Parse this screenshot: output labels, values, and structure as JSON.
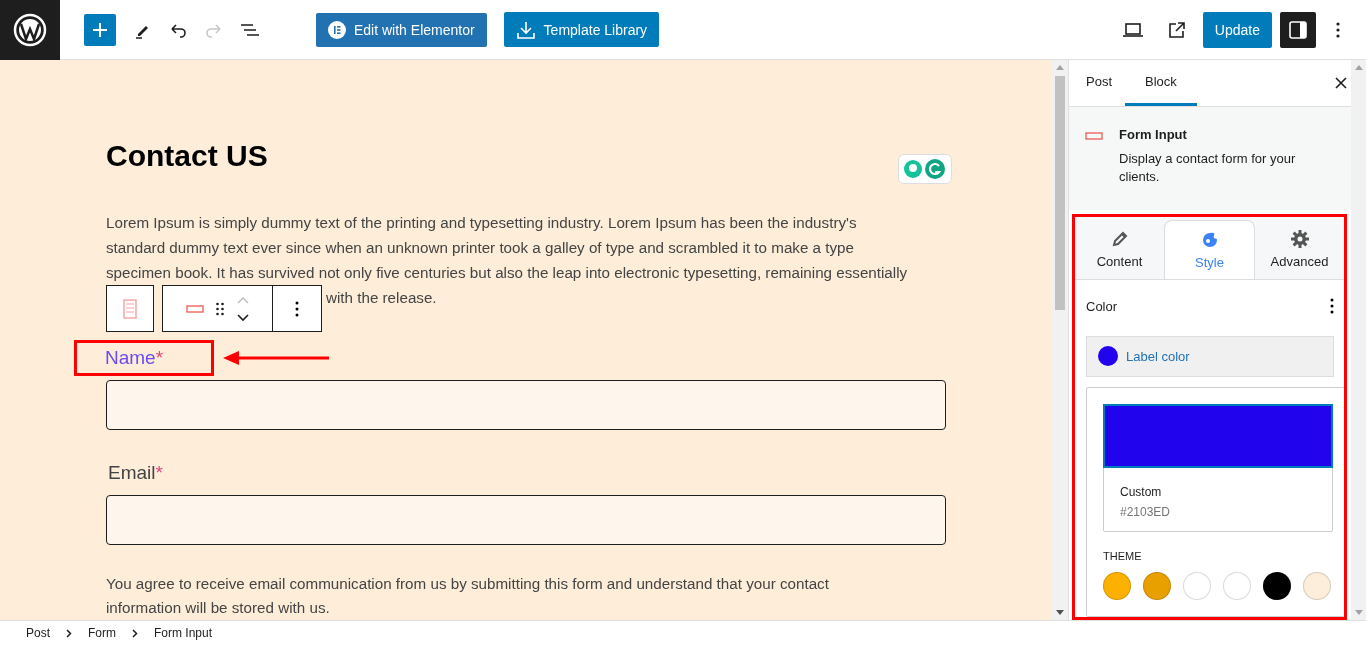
{
  "top_bar": {
    "elementor_button": "Edit with Elementor",
    "template_button": "Template Library",
    "update_button": "Update",
    "redo_disabled": true,
    "settings_open": true
  },
  "editor": {
    "title": "Contact US",
    "paragraph": "Lorem Ipsum is simply dummy text of the printing and typesetting industry. Lorem Ipsum has been the industry's standard dummy text ever since when an unknown printer took a galley of type and scrambled it to make a type specimen book. It has survived not only five centuries but also the leap into electronic typesetting, remaining essentially",
    "paragraph_tail": "with the release.",
    "fields": [
      {
        "label": "Name",
        "required_mark": "*",
        "color": "#6a4cf2",
        "highlighted": true
      },
      {
        "label": "Email",
        "required_mark": "*",
        "color": "#444444",
        "highlighted": false
      }
    ],
    "consent": "You agree to receive email communication from us by submitting this form and understand that your contact information will be stored with us."
  },
  "sidebar": {
    "tabs": [
      {
        "label": "Post",
        "selected": false
      },
      {
        "label": "Block",
        "selected": true
      }
    ],
    "block": {
      "title": "Form Input",
      "description": "Display a contact form for your clients."
    },
    "style_tabs": [
      {
        "label": "Content",
        "kind": "pencil",
        "selected": false
      },
      {
        "label": "Style",
        "kind": "palette",
        "selected": true
      },
      {
        "label": "Advanced",
        "kind": "gear",
        "selected": false
      }
    ],
    "color_panel": {
      "heading": "Color",
      "label_color": {
        "label": "Label color",
        "color": "#2103ed"
      },
      "picker": {
        "color": "#2103ed",
        "name": "Custom",
        "value": "#2103ED"
      },
      "theme_heading": "THEME",
      "swatches": [
        {
          "color": "#fcb000"
        },
        {
          "color": "#e8a000"
        },
        {
          "color": "#ffffff"
        },
        {
          "color": "#ffffff"
        },
        {
          "color": "#000000"
        },
        {
          "color": "#fdeedb"
        }
      ]
    }
  },
  "breadcrumb": [
    "Post",
    "Form",
    "Form Input"
  ]
}
